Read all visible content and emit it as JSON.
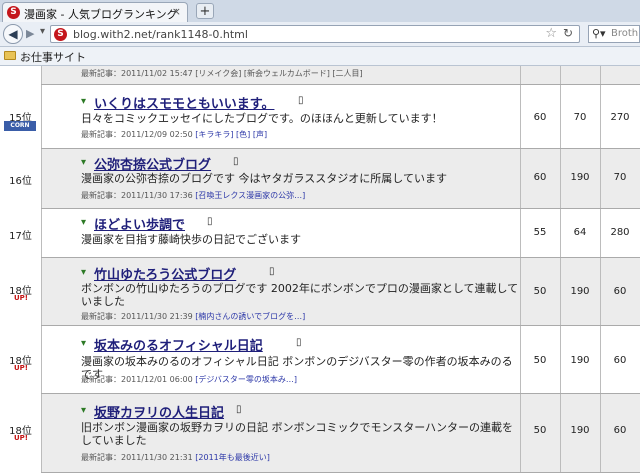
{
  "browser": {
    "tab_title": "漫画家 - 人気ブログランキング",
    "tab_close": "×",
    "new_tab": "+",
    "url": "blog.with2.net/rank1148-0.html",
    "search_placeholder": "Broth",
    "bookmark": "お仕事サイト"
  },
  "top_partial": {
    "meta": "最新記事：2011/11/02 15:47 [リメイク会] [新会ウェルカムボード] [二人目]"
  },
  "rows": [
    {
      "rank": "15位",
      "title": "いくりはスモモともいいます。",
      "desc": "日々をコミックエッセイにしたブログです。のほほんと更新しています！",
      "meta": "最新記事：2011/12/09 02:50",
      "links": "[キラキラ] [色] [声]",
      "a": "60",
      "b": "70",
      "c": "270",
      "badge": "CORN"
    },
    {
      "rank": "16位",
      "title": "公弥杏捺公式ブログ",
      "desc": "漫画家の公弥杏捺のブログです 今はヤタガラススタジオに所属しています",
      "meta": "最新記事：2011/11/30 17:36",
      "links": "[召喚王レクス漫画家の公弥…]",
      "a": "60",
      "b": "190",
      "c": "70",
      "badge": ""
    },
    {
      "rank": "17位",
      "title": "ほどよい歩調で",
      "desc": "漫画家を目指す藤崎快歩の日記でございます",
      "meta": "",
      "links": "",
      "a": "55",
      "b": "64",
      "c": "280",
      "badge": ""
    },
    {
      "rank": "18位",
      "title": "竹山ゆたろう公式ブログ",
      "desc": "ボンボンの竹山ゆたろうのブログです 2002年にボンボンでプロの漫画家として連載していました",
      "meta": "最新記事：2011/11/30 21:39",
      "links": "[楠内さんの誘いでブログを…]",
      "a": "50",
      "b": "190",
      "c": "60",
      "badge": "UP!"
    },
    {
      "rank": "18位",
      "title": "坂本みのるオフィシャル日記",
      "desc": "漫画家の坂本みのるのオフィシャル日記 ボンボンのデジバスター零の作者の坂本みのるです",
      "meta": "最新記事：2011/12/01 06:00",
      "links": "[デジバスター零の坂本み…]",
      "a": "50",
      "b": "190",
      "c": "60",
      "badge": "UP!"
    },
    {
      "rank": "18位",
      "title": "坂野カヲリの人生日記",
      "desc": "旧ボンボン漫画家の坂野カヲリの日記 ボンボンコミックでモンスターハンターの連載をしていました",
      "meta": "最新記事：2011/11/30 21:31",
      "links": "[2011年も最後近い]",
      "a": "50",
      "b": "190",
      "c": "60",
      "badge": "UP!"
    }
  ],
  "icons": {
    "mobile": "▯",
    "prefix": "▾"
  }
}
